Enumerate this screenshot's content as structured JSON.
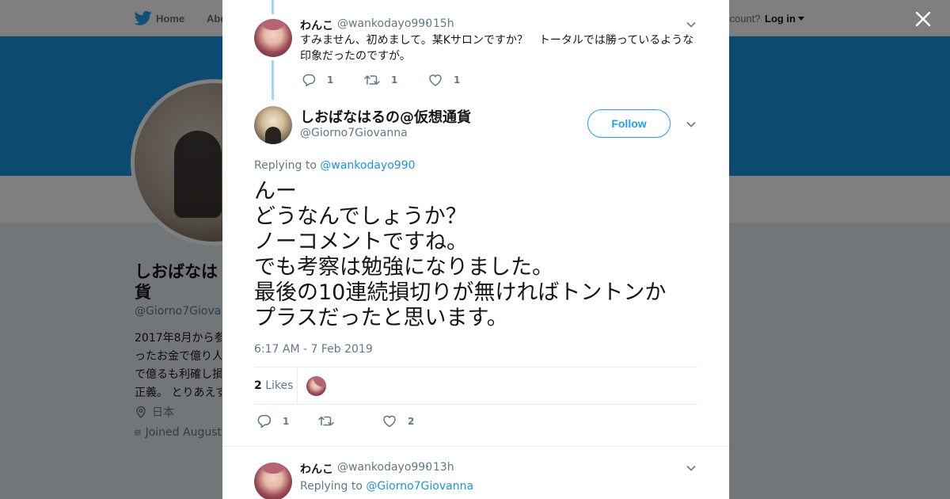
{
  "background_page": {
    "nav": {
      "home_label": "Home",
      "about_label": "Abo",
      "account_prompt": "ccount?",
      "login_label": "Log in"
    },
    "profile": {
      "name_lines": [
        "しおばなは",
        "貨"
      ],
      "handle": "@Giorno7Giovann",
      "bio_lines": [
        "2017年8月から参",
        "ったお金で億り人",
        "で億るも利確し損",
        "正義。 とりあえず"
      ],
      "location": "日本",
      "joined": "Joined August"
    }
  },
  "modal": {
    "parent_tweet": {
      "display_name": "わんこ",
      "handle": "@wankodayo990",
      "time": "· 15h",
      "text_lines": [
        "すみません、初めまして。某Kサロンですか？　トータルでは勝っているような",
        "印象だったのですが。"
      ],
      "reply_count": "1",
      "retweet_count": "1",
      "like_count": "1"
    },
    "main_tweet": {
      "display_name": "しおばなはるの@仮想通貨",
      "handle": "@Giorno7Giovanna",
      "follow_label": "Follow",
      "replying_prefix": "Replying to",
      "replying_handle": "@wankodayo990",
      "text_lines": [
        "んー",
        "どうなんでしょうか？",
        "ノーコメントですね。",
        "でも考察は勉強になりました。",
        "最後の10連続損切りが無ければトントンか",
        "プラスだったと思います。"
      ],
      "timestamp": "6:17 AM - 7 Feb 2019",
      "likes_count": "2",
      "likes_label": "Likes",
      "reply_count": "1",
      "retweet_count": "",
      "like_count": "2"
    },
    "reply_tweet": {
      "display_name": "わんこ",
      "handle": "@wankodayo990",
      "time": "· 13h",
      "replying_prefix": "Replying to",
      "replying_handle": "@Giorno7Giovanna"
    }
  },
  "colors": {
    "accent": "#1da1f2",
    "link": "#1b95e0",
    "thread_line": "#9fd6ff",
    "banner": "#1b95e0"
  },
  "icons": [
    "twitter-bird-icon",
    "close-icon",
    "chevron-down-icon",
    "reply-icon",
    "retweet-icon",
    "like-icon",
    "location-icon",
    "calendar-icon"
  ]
}
